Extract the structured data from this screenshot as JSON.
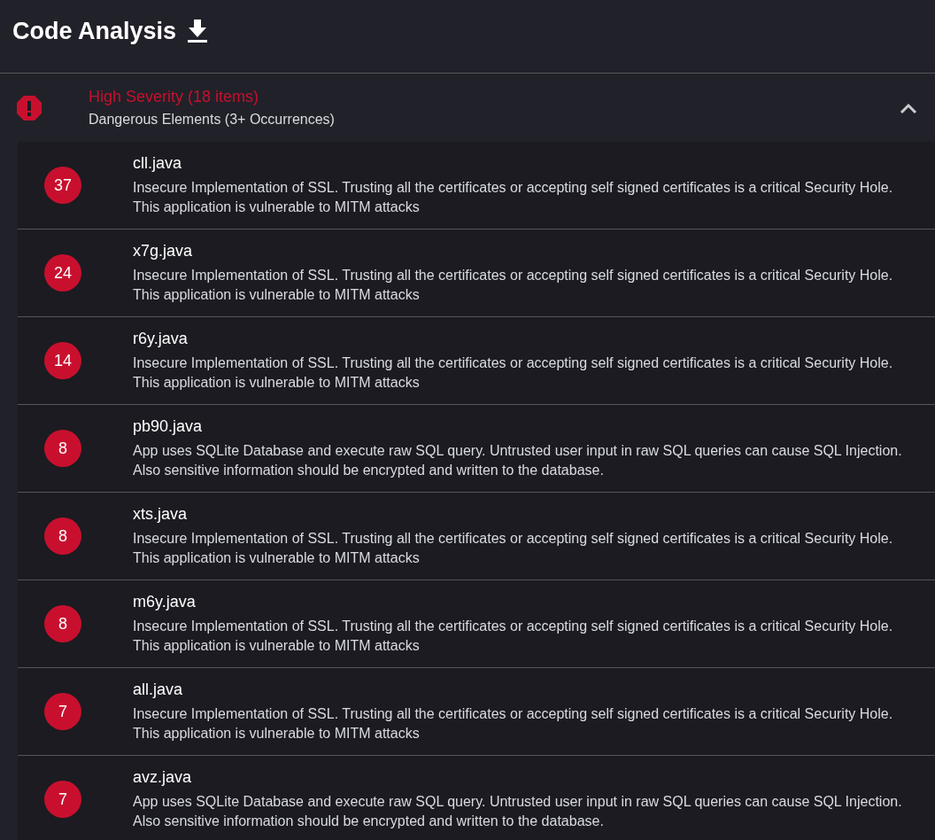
{
  "page": {
    "title": "Code Analysis"
  },
  "section": {
    "title": "High Severity (18 items)",
    "subtitle": "Dangerous Elements (3+ Occurrences)",
    "expanded": true,
    "items": [
      {
        "count": "37",
        "file": "cll.java",
        "description": "Insecure Implementation of SSL. Trusting all the certificates or accepting self signed certificates is a critical Security Hole. This application is vulnerable to MITM attacks"
      },
      {
        "count": "24",
        "file": "x7g.java",
        "description": "Insecure Implementation of SSL. Trusting all the certificates or accepting self signed certificates is a critical Security Hole. This application is vulnerable to MITM attacks"
      },
      {
        "count": "14",
        "file": "r6y.java",
        "description": "Insecure Implementation of SSL. Trusting all the certificates or accepting self signed certificates is a critical Security Hole. This application is vulnerable to MITM attacks"
      },
      {
        "count": "8",
        "file": "pb90.java",
        "description": "App uses SQLite Database and execute raw SQL query. Untrusted user input in raw SQL queries can cause SQL Injection. Also sensitive information should be encrypted and written to the database."
      },
      {
        "count": "8",
        "file": "xts.java",
        "description": "Insecure Implementation of SSL. Trusting all the certificates or accepting self signed certificates is a critical Security Hole. This application is vulnerable to MITM attacks"
      },
      {
        "count": "8",
        "file": "m6y.java",
        "description": "Insecure Implementation of SSL. Trusting all the certificates or accepting self signed certificates is a critical Security Hole. This application is vulnerable to MITM attacks"
      },
      {
        "count": "7",
        "file": "all.java",
        "description": "Insecure Implementation of SSL. Trusting all the certificates or accepting self signed certificates is a critical Security Hole. This application is vulnerable to MITM attacks"
      },
      {
        "count": "7",
        "file": "avz.java",
        "description": "App uses SQLite Database and execute raw SQL query. Untrusted user input in raw SQL queries can cause SQL Injection. Also sensitive information should be encrypted and written to the database."
      }
    ]
  }
}
